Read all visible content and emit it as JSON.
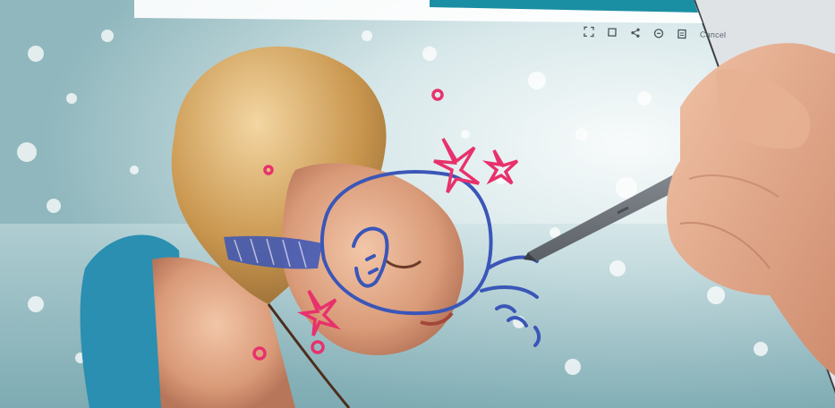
{
  "screen": {
    "accent_color": "#1a8fa3",
    "toolbar": {
      "icons": [
        "crop-icon",
        "frame-icon",
        "share-icon",
        "pen-mode-icon",
        "save-icon"
      ],
      "truncated_label": "Cancel"
    }
  },
  "scene": {
    "subject": "child-in-water-photo",
    "drawing_colors": {
      "doodle_blue": "#3a56b8",
      "doodle_pink": "#e8316c"
    },
    "stylus_color": "#8a8f96"
  }
}
